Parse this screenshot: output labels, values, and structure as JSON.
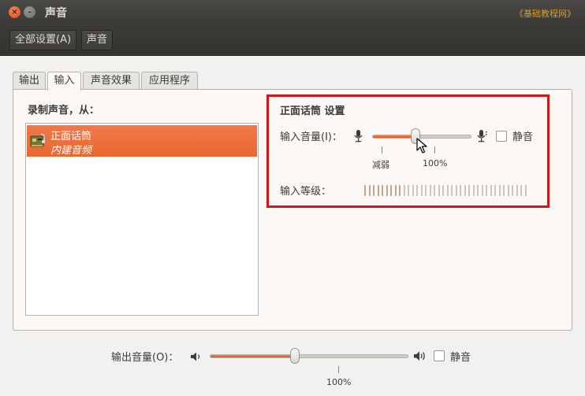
{
  "window": {
    "title": "声音",
    "close_glyph": "×",
    "minimize_glyph": "–",
    "watermark": "《基础教程网》"
  },
  "toolbar": {
    "all_settings_label": "全部设置(A)",
    "sound_label": "声音"
  },
  "tabs": [
    {
      "label": "输出",
      "active": false
    },
    {
      "label": "输入",
      "active": true
    },
    {
      "label": "声音效果",
      "active": false
    },
    {
      "label": "应用程序",
      "active": false
    }
  ],
  "input": {
    "record_from_label": "录制声音，从：",
    "devices": [
      {
        "name": "正面话筒",
        "description": "内建音频",
        "selected": true,
        "icon": "sound-card-icon"
      }
    ],
    "settings_title": "正面话筒 设置",
    "volume_label": "输入音量(I)：",
    "volume_fraction": 0.44,
    "tick_weak_label": "减弱",
    "tick_100_label": "100%",
    "mute_label": "静音",
    "mute_checked": false,
    "level_label": "输入等级：",
    "level_segments": 38,
    "level_active_segments": 9
  },
  "output": {
    "volume_label": "输出音量(O)：",
    "volume_fraction": 0.43,
    "tick_100_label": "100%",
    "mute_label": "静音",
    "mute_checked": false
  },
  "colors": {
    "accent": "#e9672f",
    "highlight_border": "#d6141c",
    "titlebar": "#3c3b37"
  }
}
